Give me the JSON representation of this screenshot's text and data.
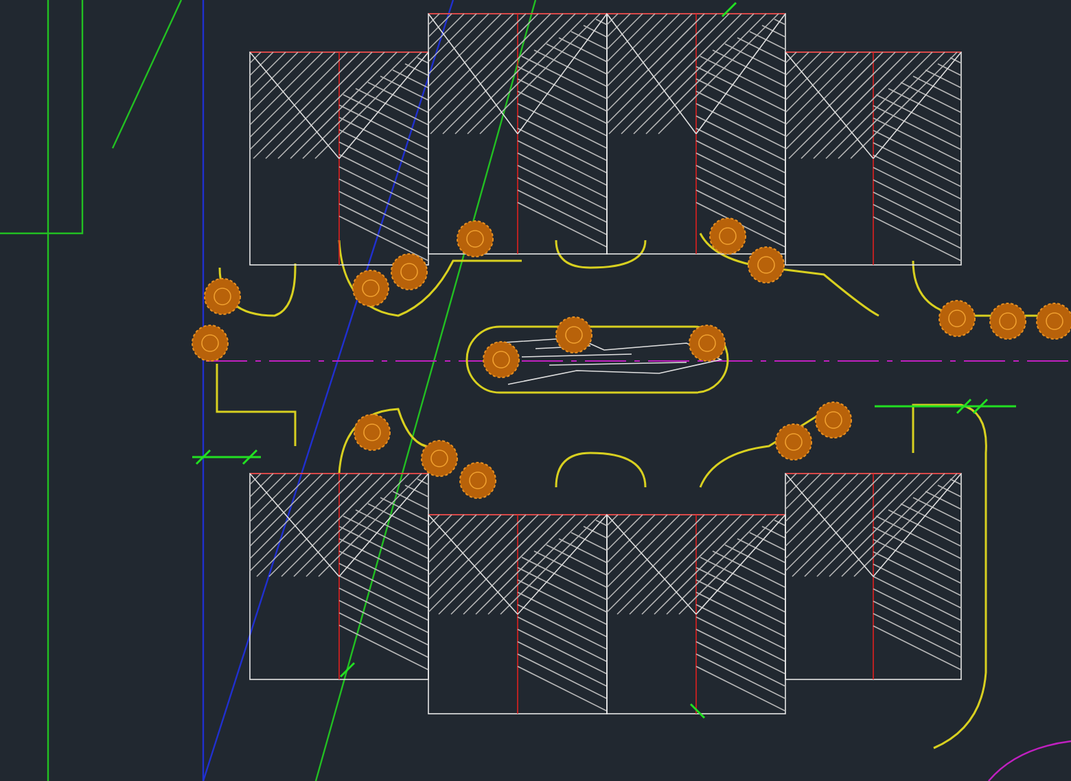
{
  "drawing": {
    "kind": "site-plan"
  }
}
